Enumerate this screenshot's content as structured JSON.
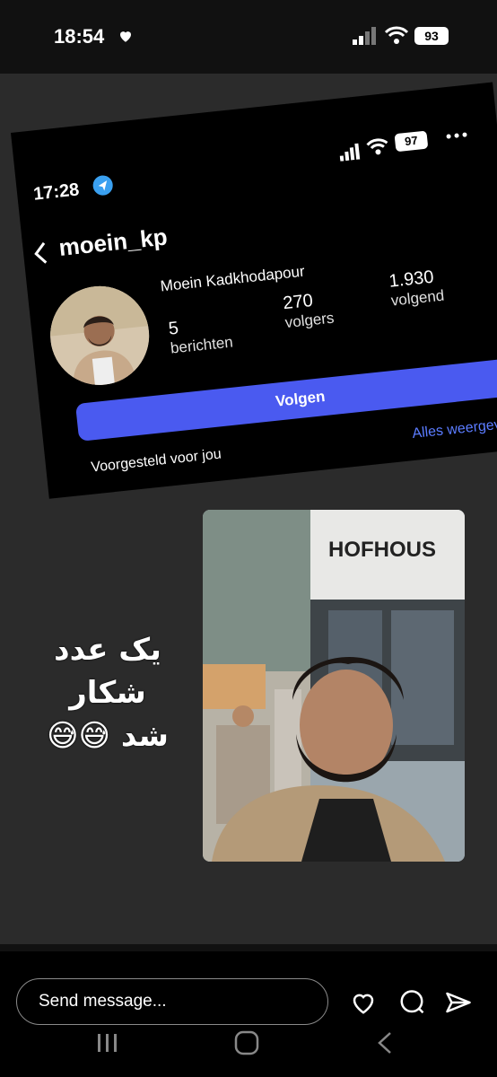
{
  "status": {
    "time": "18:54",
    "battery": "93"
  },
  "screenshot": {
    "time": "17:28",
    "battery": "97",
    "username": "moein_kp",
    "full_name": "Moein Kadkhodapour",
    "stats": [
      {
        "value": "5",
        "label": "berichten"
      },
      {
        "value": "270",
        "label": "volgers"
      },
      {
        "value": "1.930",
        "label": "volgend"
      }
    ],
    "follow_label": "Volgen",
    "suggested_label": "Voorgesteld voor jou",
    "see_all_label": "Alles weergeven"
  },
  "photo": {
    "sign_text": "HOFHOUS"
  },
  "caption": {
    "line1": "یک عدد",
    "line2": "شکار",
    "line3": "شد 😅😅"
  },
  "reply": {
    "placeholder": "Send message..."
  },
  "icons": {
    "status": [
      "heart-icon",
      "signal-icon",
      "wifi-icon",
      "battery-icon"
    ],
    "actions": [
      "heart-icon",
      "comment-icon",
      "send-icon"
    ],
    "nav": [
      "recents-icon",
      "home-icon",
      "back-icon"
    ]
  },
  "colors": {
    "follow_button": "#4a5af0",
    "link": "#5b7cff",
    "background": "#111111"
  }
}
